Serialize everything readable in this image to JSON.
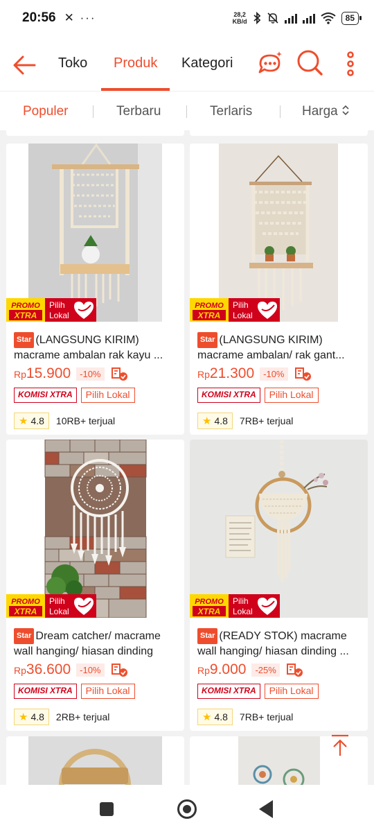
{
  "status": {
    "time": "20:56",
    "left_icons": "✕ ···",
    "net_speed_value": "28,2",
    "net_speed_unit": "KB/d",
    "battery": "85"
  },
  "nav": {
    "tabs": [
      {
        "label": "Toko",
        "active": false
      },
      {
        "label": "Produk",
        "active": true
      },
      {
        "label": "Kategori",
        "active": false
      }
    ],
    "accent": "#ee4d2d"
  },
  "sort": {
    "items": [
      {
        "label": "Populer",
        "active": true
      },
      {
        "label": "Terbaru",
        "active": false
      },
      {
        "label": "Terlaris",
        "active": false
      },
      {
        "label": "Harga",
        "active": false
      }
    ]
  },
  "badges": {
    "promo_top": "PROMO",
    "promo_bottom": "XTRA",
    "lokal_top": "Pilih",
    "lokal_bottom": "Lokal"
  },
  "products": [
    {
      "star": "Star",
      "title": "(LANGSUNG KIRIM) macrame ambalan rak kayu ...",
      "currency": "Rp",
      "price": "15.900",
      "discount": "-10%",
      "tag_komisi": "KOMISI XTRA",
      "tag_lokal": "Pilih Lokal",
      "rating": "4.8",
      "sold": "10RB+ terjual"
    },
    {
      "star": "Star",
      "title": "(LANGSUNG KIRIM) macrame ambalan/ rak gant...",
      "currency": "Rp",
      "price": "21.300",
      "discount": "-10%",
      "tag_komisi": "KOMISI XTRA",
      "tag_lokal": "Pilih Lokal",
      "rating": "4.8",
      "sold": "7RB+ terjual"
    },
    {
      "star": "Star",
      "title": "Dream catcher/ macrame wall hanging/ hiasan dinding",
      "currency": "Rp",
      "price": "36.600",
      "discount": "-10%",
      "tag_komisi": "KOMISI XTRA",
      "tag_lokal": "Pilih Lokal",
      "rating": "4.8",
      "sold": "2RB+ terjual"
    },
    {
      "star": "Star",
      "title": "(READY STOK) macrame wall hanging/ hiasan dinding ...",
      "currency": "Rp",
      "price": "9.000",
      "discount": "-25%",
      "tag_komisi": "KOMISI XTRA",
      "tag_lokal": "Pilih Lokal",
      "rating": "4.8",
      "sold": "7RB+ terjual"
    }
  ]
}
